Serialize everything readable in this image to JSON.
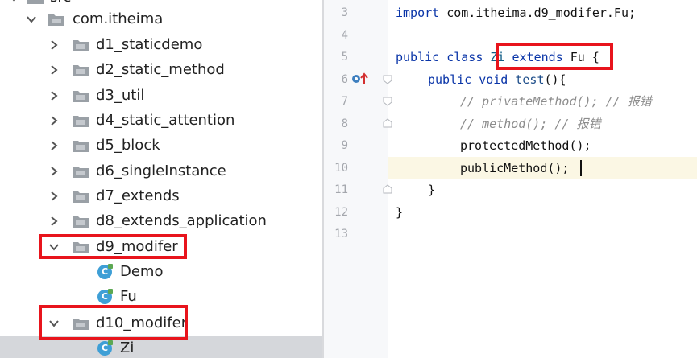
{
  "tree": {
    "rows": [
      {
        "label": "src",
        "kind": "folder",
        "expanded": true
      },
      {
        "label": "com.itheima",
        "kind": "package",
        "expanded": true
      },
      {
        "label": "d1_staticdemo",
        "kind": "package",
        "expanded": false
      },
      {
        "label": "d2_static_method",
        "kind": "package",
        "expanded": false
      },
      {
        "label": "d3_util",
        "kind": "package",
        "expanded": false
      },
      {
        "label": "d4_static_attention",
        "kind": "package",
        "expanded": false
      },
      {
        "label": "d5_block",
        "kind": "package",
        "expanded": false
      },
      {
        "label": "d6_singleInstance",
        "kind": "package",
        "expanded": false
      },
      {
        "label": "d7_extends",
        "kind": "package",
        "expanded": false
      },
      {
        "label": "d8_extends_application",
        "kind": "package",
        "expanded": false
      },
      {
        "label": "d9_modifer",
        "kind": "package",
        "expanded": true
      },
      {
        "label": "Demo",
        "kind": "class",
        "icon_letter": "C"
      },
      {
        "label": "Fu",
        "kind": "class",
        "icon_letter": "C"
      },
      {
        "label": "d10_modifer",
        "kind": "package",
        "expanded": true
      },
      {
        "label": "Zi",
        "kind": "class",
        "icon_letter": "C",
        "selected": true
      }
    ]
  },
  "editor": {
    "line_numbers": [
      "3",
      "4",
      "5",
      "6",
      "7",
      "8",
      "9",
      "10",
      "11",
      "12",
      "13"
    ],
    "lines": {
      "l3_kw": "import ",
      "l3_rest": "com.itheima.d9_modifer.Fu;",
      "l5_kw1": "public class ",
      "l5_name": "Zi",
      "l5_kw2": " extends ",
      "l5_super": "Fu",
      "l5_brace": " {",
      "l6_kw": "public void ",
      "l6_fn": "test",
      "l6_rest": "(){",
      "l7_comment": "// privateMethod(); // 报错",
      "l8_comment": "// method(); // 报错",
      "l9_code": "protectedMethod();",
      "l10_code": "publicMethod();",
      "l11_code": "}",
      "l12_code": "}"
    }
  },
  "colors": {
    "highlight_box": "#e8141c",
    "keyword": "#0a35a8",
    "comment": "#8c8c8c",
    "class_icon": "#3e9fd6",
    "selection": "#d5d7db",
    "current_line": "#fbf7e4"
  },
  "icons": {
    "expanded": "chevron-down-icon",
    "collapsed": "chevron-right-icon",
    "package": "package-folder-icon",
    "class": "java-class-icon",
    "override": "override-up-arrow-icon"
  }
}
